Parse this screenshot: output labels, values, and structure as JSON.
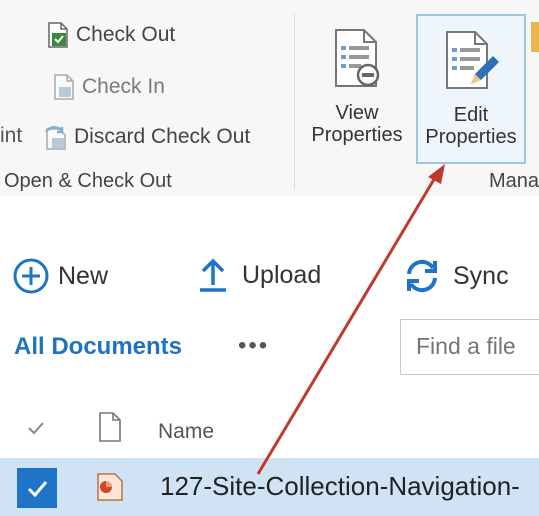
{
  "ribbon": {
    "checkout_label": "Check Out",
    "checkin_label": "Check In",
    "partial_left_label": "int",
    "discard_label": "Discard Check Out",
    "group_open_label": "Open & Check Out",
    "view_properties_line1": "View",
    "view_properties_line2": "Properties",
    "edit_properties_line1": "Edit",
    "edit_properties_line2": "Properties",
    "group_manage_label": "Mana"
  },
  "commands": {
    "new_label": "New",
    "upload_label": "Upload",
    "sync_label": "Sync"
  },
  "view": {
    "title": "All Documents",
    "more": "•••",
    "search_placeholder": "Find a file"
  },
  "list": {
    "header_name": "Name",
    "rows": [
      {
        "name": "127-Site-Collection-Navigation-",
        "selected": true
      }
    ]
  },
  "colors": {
    "accent": "#1e74c8",
    "selected_row": "#cfe3f4",
    "arrow": "#c0392b"
  }
}
